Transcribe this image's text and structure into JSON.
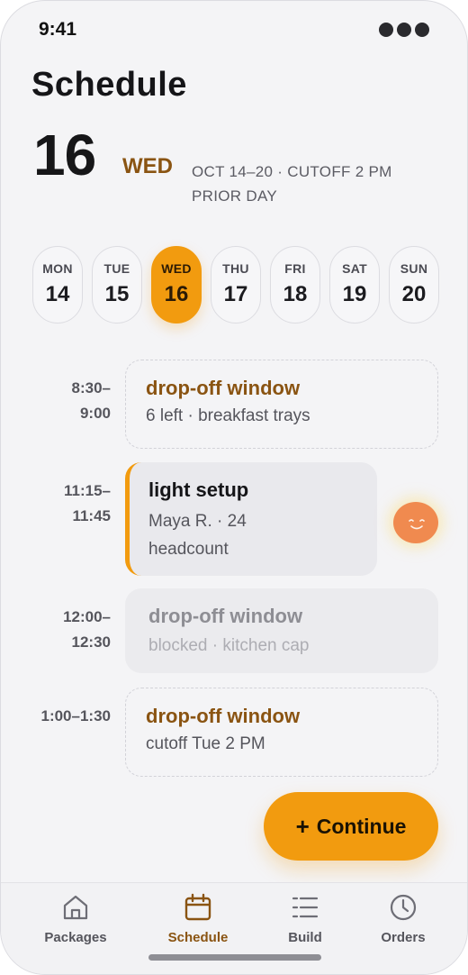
{
  "status_bar": {
    "time": "9:41"
  },
  "header": {
    "title": "Schedule"
  },
  "selected_date": {
    "day_number": "16",
    "day_of_week": "WED",
    "week_info": "OCT 14–20 · CUTOFF 2 PM PRIOR DAY"
  },
  "days": [
    {
      "name": "MON",
      "date": "14",
      "selected": false
    },
    {
      "name": "TUE",
      "date": "15",
      "selected": false
    },
    {
      "name": "WED",
      "date": "16",
      "selected": true
    },
    {
      "name": "THU",
      "date": "17",
      "selected": false
    },
    {
      "name": "FRI",
      "date": "18",
      "selected": false
    },
    {
      "name": "SAT",
      "date": "19",
      "selected": false
    },
    {
      "name": "SUN",
      "date": "20",
      "selected": false
    }
  ],
  "slots": [
    {
      "time": "8:30–\n9:00",
      "title": "drop-off window",
      "subtitle": "6 left · breakfast trays",
      "state": "available"
    },
    {
      "time": "11:15–\n11:45",
      "title": "light setup",
      "subtitle": "Maya R. · 24 headcount",
      "state": "booked"
    },
    {
      "time": "12:00–\n12:30",
      "title": "drop-off window",
      "subtitle": "blocked · kitchen cap",
      "state": "blocked"
    },
    {
      "time": "1:00–1:30",
      "title": "drop-off window",
      "subtitle": "cutoff Tue 2 PM",
      "state": "available"
    }
  ],
  "continue_button": {
    "plus": "+",
    "label": "Continue"
  },
  "nav": [
    {
      "label": "Packages",
      "icon": "home-icon",
      "active": false
    },
    {
      "label": "Schedule",
      "icon": "calendar-icon",
      "active": true
    },
    {
      "label": "Build",
      "icon": "list-icon",
      "active": false
    },
    {
      "label": "Orders",
      "icon": "clock-icon",
      "active": false
    }
  ],
  "colors": {
    "accent": "#f29b0f",
    "accent_text": "#8a5412",
    "background": "#f4f4f6"
  }
}
